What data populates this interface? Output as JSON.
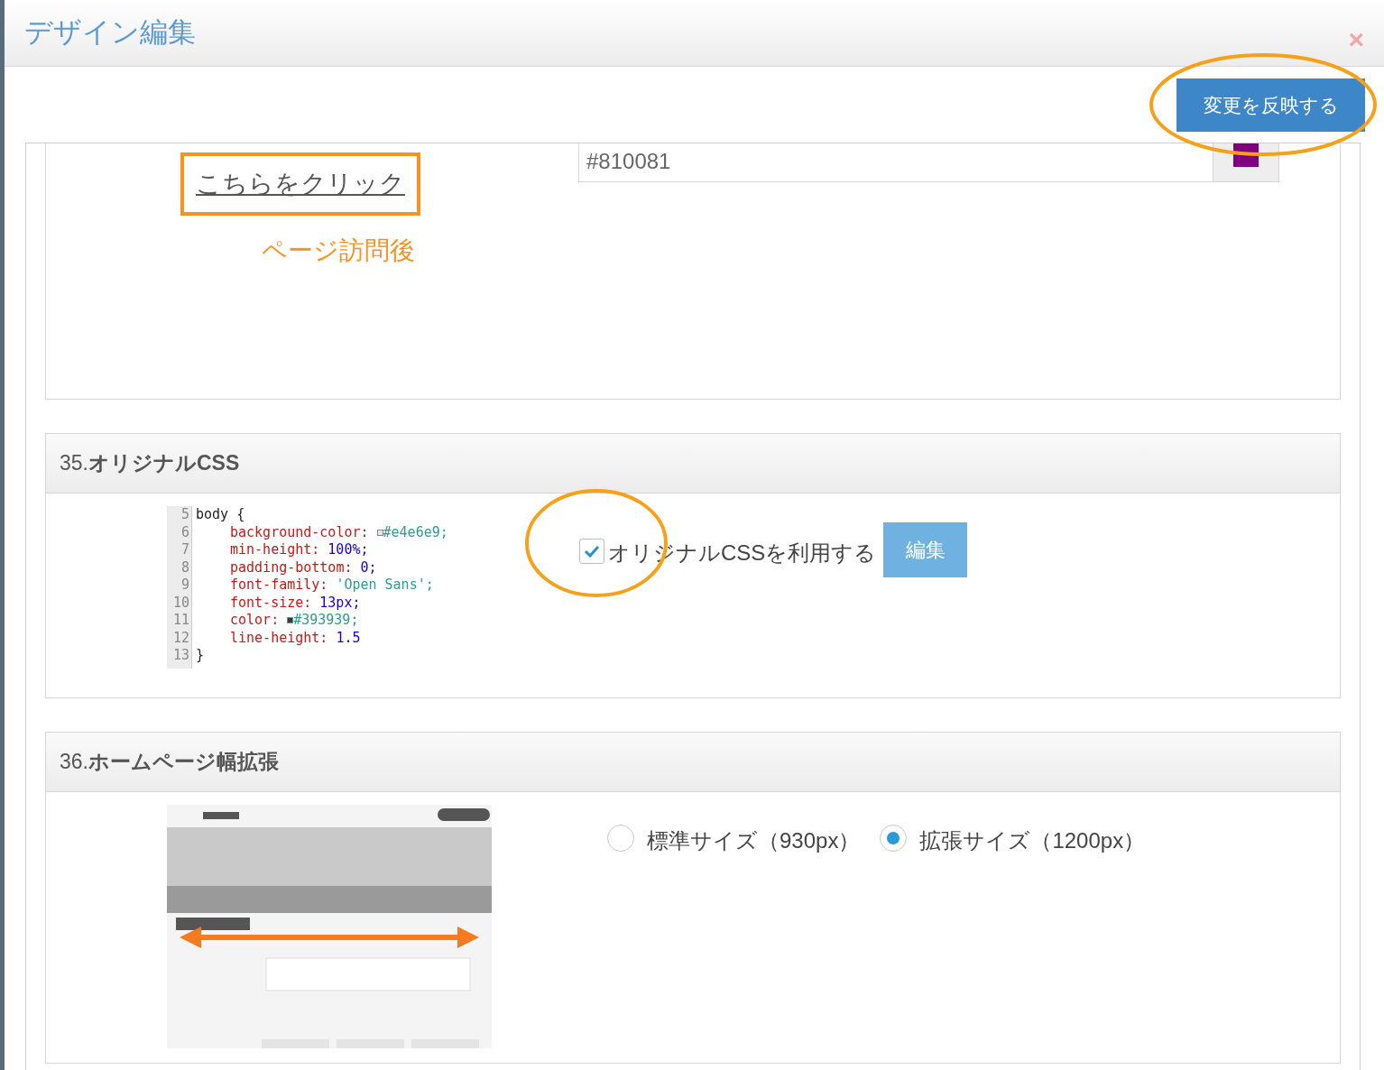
{
  "dialog": {
    "title": "デザイン編集",
    "close": "×"
  },
  "apply_button": "変更を反映する",
  "partial_section": {
    "preview_link": "こちらをクリック",
    "preview_caption": "ページ訪問後",
    "color_field": {
      "value": "#810081"
    }
  },
  "sections": [
    {
      "kind": "css",
      "heading": "35.**オリジナルCSS**",
      "code_preview": [
        {
          "number": "5",
          "kind": "plain",
          "text": "body {"
        },
        {
          "number": "6",
          "kind": "color",
          "property": "background-color:",
          "value": "#e4e6e9;"
        },
        {
          "number": "7",
          "kind": "rule",
          "property": "min-height:",
          "value": "100%;"
        },
        {
          "number": "8",
          "kind": "rule",
          "property": "padding-bottom:",
          "value": "0;"
        },
        {
          "number": "9",
          "kind": "string",
          "property": "font-family:",
          "value": "'Open Sans';"
        },
        {
          "number": "10",
          "kind": "rule",
          "property": "font-size:",
          "value": "13px;"
        },
        {
          "number": "11",
          "kind": "color",
          "property": "color:",
          "value": "#393939;"
        },
        {
          "number": "12",
          "kind": "rule",
          "property": "line-height:",
          "value": "1.5"
        },
        {
          "number": "13",
          "kind": "plain",
          "text": "}"
        }
      ],
      "checkbox": {
        "label": "オリジナルCSSを利用する",
        "checked": true
      },
      "edit_button": "編集"
    },
    {
      "kind": "width",
      "heading": "36.**ホームページ幅拡張**",
      "options": [
        {
          "label": "標準サイズ（930px）",
          "selected": false
        },
        {
          "label": "拡張サイズ（1200px）",
          "selected": true
        }
      ]
    }
  ]
}
